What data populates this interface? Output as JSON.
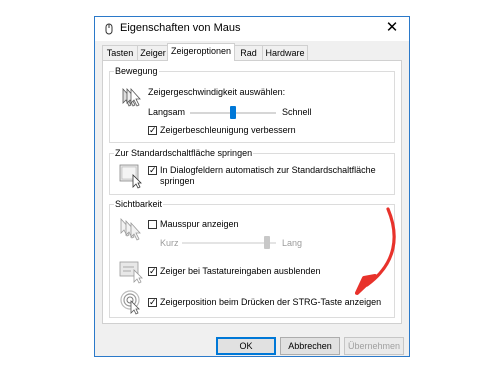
{
  "window": {
    "title": "Eigenschaften von Maus",
    "close_glyph": "✕"
  },
  "tabs": [
    {
      "label": "Tasten",
      "active": false
    },
    {
      "label": "Zeiger",
      "active": false
    },
    {
      "label": "Zeigeroptionen",
      "active": true
    },
    {
      "label": "Rad",
      "active": false
    },
    {
      "label": "Hardware",
      "active": false
    }
  ],
  "motion": {
    "group_label": "Bewegung",
    "speed_label": "Zeigergeschwindigkeit auswählen:",
    "slow_label": "Langsam",
    "fast_label": "Schnell",
    "speed_value": 0.5,
    "precision_label": "Zeigerbeschleunigung verbessern",
    "precision_checked": true,
    "icon": "pointer-speed-icon"
  },
  "snap": {
    "group_label": "Zur Standardschaltfläche springen",
    "checkbox_label_line1": "In Dialogfeldern automatisch zur Standardschaltfläche",
    "checkbox_label_line2": "springen",
    "checked": true,
    "icon": "snap-to-default-icon"
  },
  "visibility": {
    "group_label": "Sichtbarkeit",
    "trails_label": "Mausspur anzeigen",
    "trails_checked": false,
    "short_label": "Kurz",
    "long_label": "Lang",
    "trails_length_value": 0.9,
    "hide_label": "Zeiger bei Tastatureingaben ausblenden",
    "hide_checked": true,
    "ctrl_label": "Zeigerposition beim Drücken der STRG-Taste anzeigen",
    "ctrl_checked": true,
    "icons": [
      "pointer-trails-icon",
      "hide-pointer-icon",
      "show-location-icon"
    ]
  },
  "buttons": {
    "ok": "OK",
    "cancel": "Abbrechen",
    "apply": "Übernehmen"
  },
  "check_glyph": "✓",
  "colors": {
    "accent": "#0078d7",
    "annotation_arrow": "#e8322b",
    "window_border": "#2b79c9"
  }
}
